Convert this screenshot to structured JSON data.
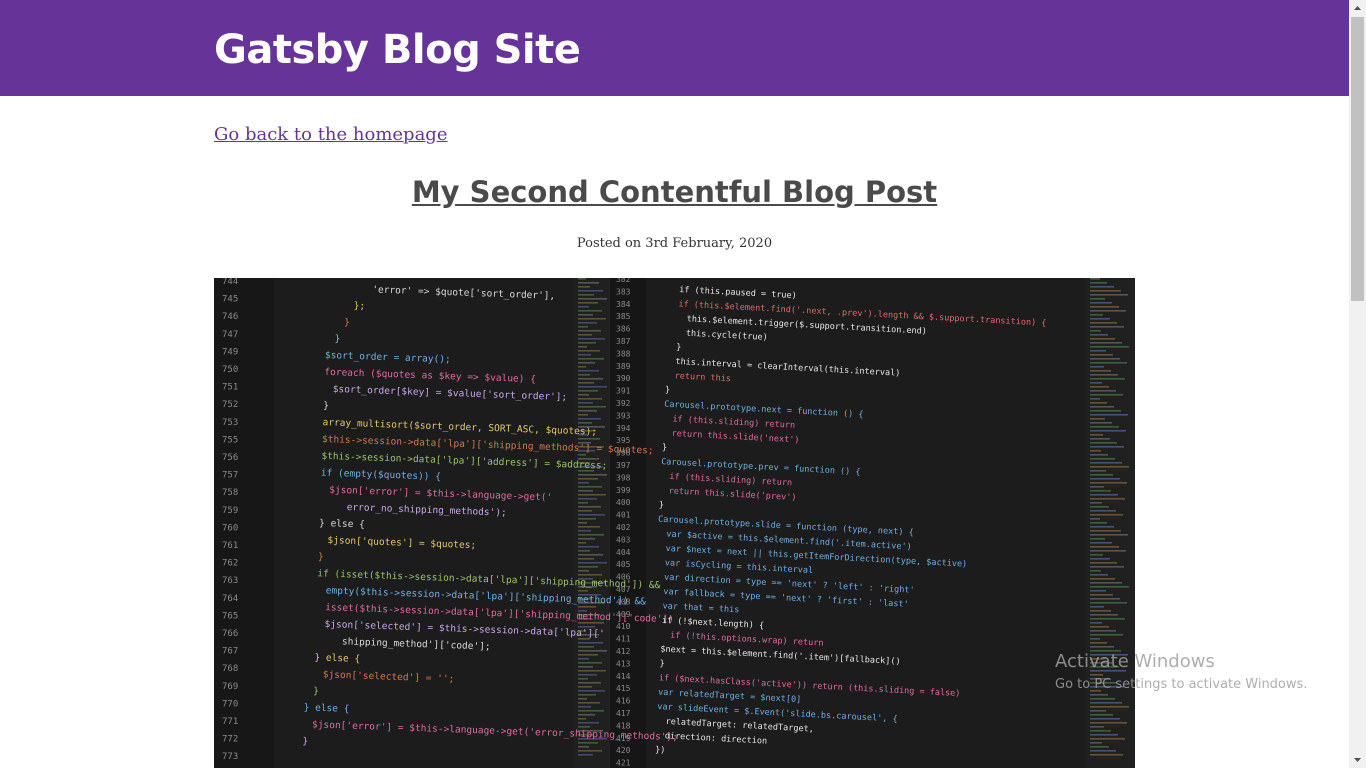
{
  "header": {
    "site_title": "Gatsby Blog Site",
    "background_color": "#663399"
  },
  "navigation": {
    "back_link": "Go back to the homepage"
  },
  "post": {
    "title": "My Second Contentful Blog Post",
    "date": "Posted on 3rd February, 2020",
    "image": {
      "description": "code-editor-screenshot",
      "left_gutter_numbers": [
        "744",
        "745",
        "746",
        "747",
        "749",
        "750",
        "751",
        "752",
        "753",
        "755",
        "756",
        "757",
        "758",
        "759",
        "760",
        "761",
        "762",
        "763",
        "764",
        "765",
        "766",
        "767",
        "768",
        "769",
        "770",
        "771",
        "772",
        "773"
      ],
      "left_code_lines": [
        "'error' => $quote['sort_order'],",
        "};",
        "}",
        "}",
        "$sort_order = array();",
        "foreach ($quotes as $key => $value) {",
        "$sort_order[$key] = $value['sort_order'];",
        "}",
        "array_multisort($sort_order, SORT_ASC, $quotes);",
        "$this->session->data['lpa']['shipping_methods'] = $quotes;",
        "$this->session->data['lpa']['address'] = $address;",
        "if (empty($quotes)) {",
        "$json['error'] = $this->language->get('",
        "error_no_shipping_methods');",
        "} else {",
        "$json['quotes'] = $quotes;",
        "}",
        "if (isset($this->session->data['lpa']['shipping_method']) &&",
        "empty($this->session->data['lpa']['shipping_method']) &&",
        "isset($this->session->data['lpa']['shipping_method']['code'])",
        "$json['selected'] = $this->session->data['lpa']['",
        "shipping_method']['code'];",
        "} else {",
        "$json['selected'] = '';",
        "}",
        "} else {",
        "$json['error'] = $this->language->get('error_shipping_methods');",
        "}"
      ],
      "right_gutter_numbers": [
        "382",
        "383",
        "384",
        "385",
        "386",
        "387",
        "388",
        "389",
        "390",
        "391",
        "392",
        "393",
        "394",
        "395",
        "396",
        "397",
        "398",
        "399",
        "400",
        "401",
        "402",
        "403",
        "404",
        "405",
        "406",
        "407",
        "408",
        "409",
        "410",
        "411",
        "412",
        "413",
        "414",
        "415",
        "416",
        "417",
        "418",
        "419",
        "420",
        "421"
      ],
      "right_code_lines": [
        "if (this.paused = true)",
        "if (this.$element.find('.next, .prev').length && $.support.transition) {",
        "this.$element.trigger($.support.transition.end)",
        "this.cycle(true)",
        "}",
        "this.interval = clearInterval(this.interval)",
        "return this",
        "}",
        "Carousel.prototype.next = function () {",
        "if (this.sliding) return",
        "return this.slide('next')",
        "}",
        "Carousel.prototype.prev = function () {",
        "if (this.sliding) return",
        "return this.slide('prev')",
        "}",
        "Carousel.prototype.slide = function (type, next) {",
        "var $active   = this.$element.find('.item.active')",
        "var $next     = next || this.getItemForDirection(type, $active)",
        "var isCycling = this.interval",
        "var direction = type == 'next' ? 'left' : 'right'",
        "var fallback  = type == 'next' ? 'first' : 'last'",
        "var that      = this",
        "if (!$next.length) {",
        "if (!this.options.wrap) return",
        "$next = this.$element.find('.item')[fallback]()",
        "}",
        "if ($next.hasClass('active')) return (this.sliding = false)",
        "var relatedTarget = $next[0]",
        "var slideEvent = $.Event('slide.bs.carousel', {",
        "relatedTarget: relatedTarget,",
        "direction: direction",
        "})"
      ]
    }
  },
  "system_overlay": {
    "watermark_title": "Activate Windows",
    "watermark_subtitle": "Go to PC settings to activate Windows."
  }
}
